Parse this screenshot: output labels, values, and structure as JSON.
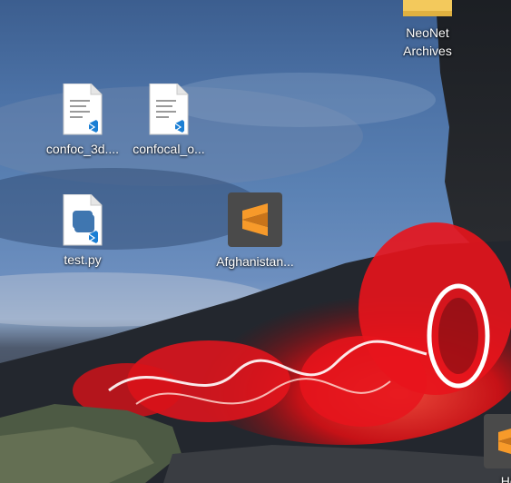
{
  "desktop": {
    "icons": [
      {
        "name": "folder",
        "label1": "NeoNet",
        "label2": "Archives",
        "type": "folder-icon"
      },
      {
        "name": "file-confoc-3d",
        "label": "confoc_3d....",
        "type": "vscode-file-icon"
      },
      {
        "name": "file-confocal",
        "label": "confocal_o...",
        "type": "vscode-file-icon"
      },
      {
        "name": "file-test-py",
        "label": "test.py",
        "type": "python-file-icon"
      },
      {
        "name": "file-afghanistan",
        "label": "Afghanistan...",
        "type": "sublime-file-icon"
      },
      {
        "name": "file-her",
        "label": "Her",
        "type": "sublime-file-icon"
      }
    ]
  },
  "colors": {
    "sky": "#4c72a6",
    "light_painting": "#e8141c",
    "sublime_orange": "#f79a2a",
    "sublime_bg": "#4a4a4a",
    "vscode_blue": "#1b7fd4",
    "folder": "#f3c95c"
  }
}
